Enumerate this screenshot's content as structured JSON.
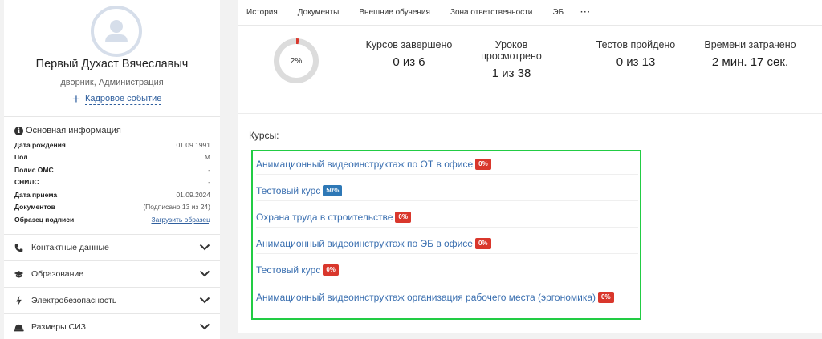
{
  "profile": {
    "name": "Первый Духаст Вячеславыч",
    "role": "дворник, Администрация",
    "hr_event_label": "Кадровое событие"
  },
  "basic_info": {
    "title": "Основная информация",
    "rows": [
      {
        "key": "Дата рождения",
        "value": "01.09.1991"
      },
      {
        "key": "Пол",
        "value": "М"
      },
      {
        "key": "Полис ОМС",
        "value": "-"
      },
      {
        "key": "СНИЛС",
        "value": "-"
      },
      {
        "key": "Дата приема",
        "value": "01.09.2024"
      },
      {
        "key": "Документов",
        "value": "(Подписано 13 из 24)"
      },
      {
        "key": "Образец подписи",
        "value": "Загрузить образец"
      }
    ]
  },
  "accordion": [
    {
      "label": "Контактные данные",
      "icon": "phone-icon"
    },
    {
      "label": "Образование",
      "icon": "graduation-cap-icon"
    },
    {
      "label": "Электробезопасность",
      "icon": "lightning-icon"
    },
    {
      "label": "Размеры СИЗ",
      "icon": "helmet-icon"
    }
  ],
  "tabs": [
    "История",
    "Документы",
    "Внешние обучения",
    "Зона ответственности",
    "ЭБ",
    "···"
  ],
  "progress": {
    "percent_label": "2%",
    "value": 0.02
  },
  "stats": [
    {
      "title": "Курсов завершено",
      "value": "0 из 6"
    },
    {
      "title": "Уроков просмотрено",
      "value": "1 из 38"
    },
    {
      "title": "Тестов пройдено",
      "value": "0 из 13"
    },
    {
      "title": "Времени затрачено",
      "value": "2 мин. 17 сек."
    }
  ],
  "courses_label": "Курсы:",
  "courses": [
    {
      "name": "Анимационный видеоинструктаж по ОТ в офисе",
      "badge": "0%",
      "badge_color": "#d9372c"
    },
    {
      "name": "Тестовый курс",
      "badge": "50%",
      "badge_color": "#2e78b6"
    },
    {
      "name": "Охрана труда в строительстве",
      "badge": "0%",
      "badge_color": "#d9372c"
    },
    {
      "name": "Анимационный видеоинструктаж по ЭБ в офисе",
      "badge": "0%",
      "badge_color": "#d9372c"
    },
    {
      "name": "Тестовый курс",
      "badge": "0%",
      "badge_color": "#d9372c"
    },
    {
      "name": "Анимационный видеоинструктаж организация рабочего места (эргономика)",
      "badge": "0%",
      "badge_color": "#d9372c"
    }
  ],
  "colors": {
    "link": "#3a6fb0",
    "highlight": "#22cc44",
    "badge_red": "#d9372c",
    "badge_blue": "#2e78b6"
  }
}
